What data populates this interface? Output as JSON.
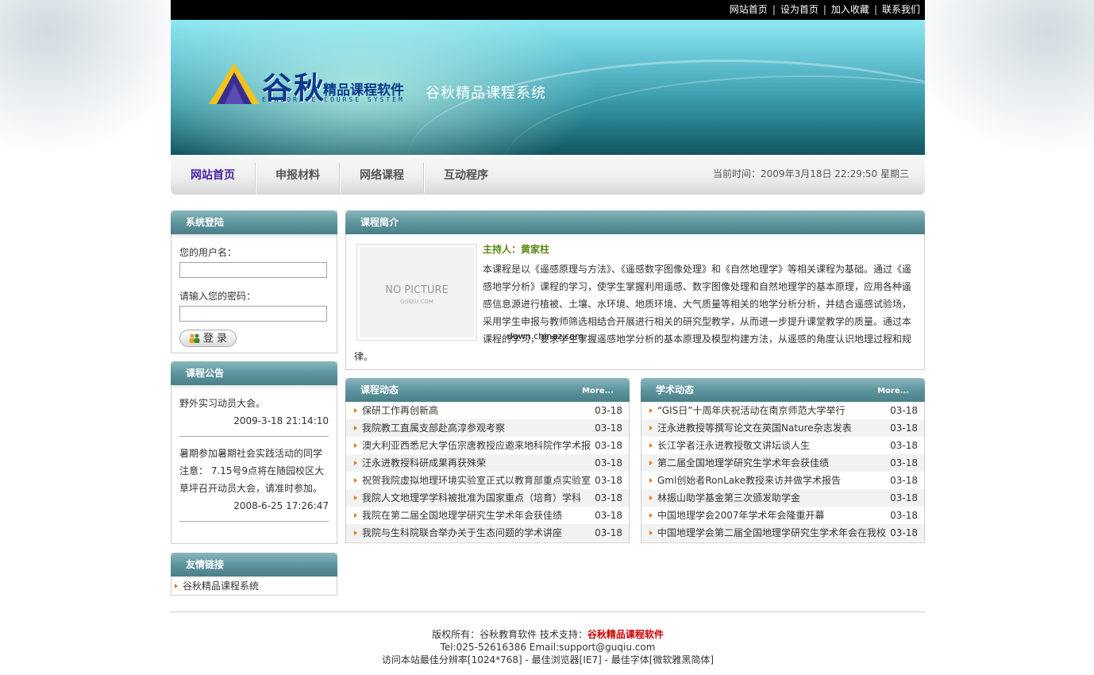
{
  "topbar": {
    "links": [
      "网站首页",
      "设为首页",
      "加入收藏",
      "联系我们"
    ],
    "sep": "|"
  },
  "banner": {
    "logo_main": "谷秋",
    "logo_sub": "精品课程软件",
    "logo_en": "ELABORATE COURSE SYSTEM",
    "title": "谷秋精品课程系统"
  },
  "nav": {
    "items": [
      "网站首页",
      "申报材料",
      "网络课程",
      "互动程序"
    ],
    "time": "当前时间：2009年3月18日 22:29:50 星期三"
  },
  "login": {
    "title": "系统登陆",
    "username_label": "您的用户名：",
    "password_label": "请输入您的密码：",
    "button": "登 录"
  },
  "notice": {
    "title": "课程公告",
    "items": [
      {
        "text": "野外实习动员大会。",
        "date": "2009-3-18 21:14:10"
      },
      {
        "text": "暑期参加暑期社会实践活动的同学注意： 7.15号9点将在随园校区大草坪召开动员大会，请准时参加。",
        "date": "2008-6-25 17:26:47"
      }
    ]
  },
  "friends": {
    "title": "友情链接",
    "items": [
      "谷秋精品课程系统"
    ]
  },
  "intro": {
    "title": "课程简介",
    "no_picture": "NO PICTURE",
    "no_picture_sub": "GUQIU.COM",
    "host": "主持人：黄家柱",
    "body": "本课程是以《遥感原理与方法》、《遥感数字图像处理》和《自然地理学》等相关课程为基础。通过《遥感地学分析》课程的学习，使学生掌握利用遥感、数字图像处理和自然地理学的基本原理，应用各种遥感信息源进行植被、土壤、水环境、地质环境、大气质量等相关的地学分析分析，并结合遥感试验场，采用学生申报与教师筛选相结合开展进行相关的研究型教学，从而进一步提升课堂教学的质量。通过本课程的学习，要求学生掌握遥感地学分析的基本原理及模型构建方法，从遥感的角度认识地理过程和规律。",
    "watermark": "down.chinaz.com"
  },
  "course_news": {
    "title": "课程动态",
    "more": "More...",
    "items": [
      {
        "text": "保研工作再创新高",
        "date": "03-18"
      },
      {
        "text": "我院教工直属支部赴高淳参观考察",
        "date": "03-18"
      },
      {
        "text": "澳大利亚西悉尼大学伍宗唐教授应邀来地科院作学术报",
        "date": "03-18"
      },
      {
        "text": "汪永进教授科研成果再获殊荣",
        "date": "03-18"
      },
      {
        "text": "祝贺我院虚拟地理环境实验室正式以教育部重点实验室",
        "date": "03-18"
      },
      {
        "text": "我院人文地理学学科被批准为国家重点（培育）学科",
        "date": "03-18"
      },
      {
        "text": "我院在第二届全国地理学研究生学术年会获佳绩",
        "date": "03-18"
      },
      {
        "text": "我院与生科院联合举办关于生态问题的学术讲座",
        "date": "03-18"
      }
    ]
  },
  "academic_news": {
    "title": "学术动态",
    "more": "More...",
    "items": [
      {
        "text": "“GIS日”十周年庆祝活动在南京师范大学举行",
        "date": "03-18"
      },
      {
        "text": "汪永进教授等撰写论文在英国Nature杂志发表",
        "date": "03-18"
      },
      {
        "text": "长江学者汪永进教授敬文讲坛谈人生",
        "date": "03-18"
      },
      {
        "text": "第二届全国地理学研究生学术年会获佳绩",
        "date": "03-18"
      },
      {
        "text": "Gml创始者RonLake教授来访并做学术报告",
        "date": "03-18"
      },
      {
        "text": "林振山助学基金第三次颁发助学金",
        "date": "03-18"
      },
      {
        "text": "中国地理学会2007年学术年会隆重开幕",
        "date": "03-18"
      },
      {
        "text": "中国地理学会第二届全国地理学研究生学术年会在我校",
        "date": "03-18"
      }
    ]
  },
  "footer": {
    "copyright_prefix": "版权所有：谷秋教育软件  技术支持：",
    "copyright_brand": "谷秋精品课程软件",
    "contact": "Tel:025-52616386  Email:support@guqiu.com",
    "advice": "访问本站最佳分辨率[1024*768] - 最佳浏览器[IE7] - 最佳字体[微软雅黑简体]"
  }
}
